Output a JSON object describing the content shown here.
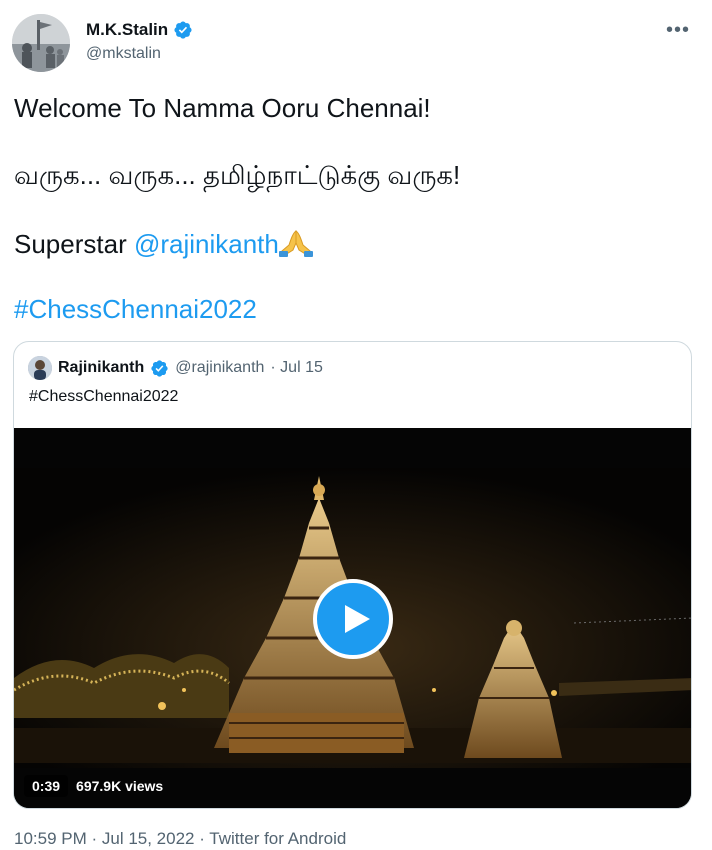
{
  "tweet": {
    "author_name": "M.K.Stalin",
    "author_handle": "@mkstalin",
    "more_label": "•••",
    "line1": "Welcome To Namma Ooru Chennai!",
    "line2": "வருக... வருக... தமிழ்நாட்டுக்கு வருக!",
    "line3_prefix": "Superstar ",
    "mention": "@rajinikanth",
    "hashtag": "#ChessChennai2022",
    "timestamp": "10:59 PM · Jul 15, 2022 · Twitter for Android"
  },
  "quote": {
    "author_name": "Rajinikanth",
    "author_handle": "@rajinikanth",
    "date": "· Jul 15",
    "text": "#ChessChennai2022",
    "video_duration": "0:39",
    "video_views": "697.9K views"
  },
  "colors": {
    "link": "#1d9bf0",
    "verified": "#1d9bf0",
    "text": "#0f1419",
    "muted": "#536471",
    "border": "#cfd9de"
  },
  "icons": [
    "verified-badge-icon",
    "more-icon",
    "play-icon",
    "folded-hands-emoji"
  ]
}
